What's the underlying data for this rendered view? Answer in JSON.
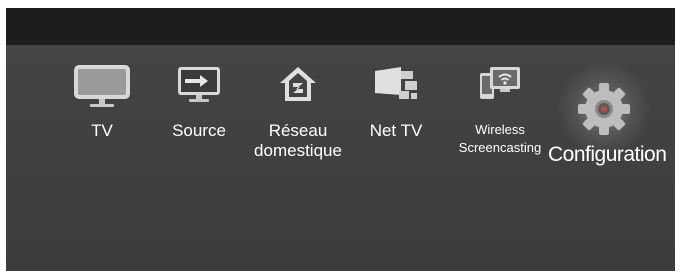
{
  "menu": {
    "items": [
      {
        "label": "TV",
        "icon": "tv-icon"
      },
      {
        "label": "Source",
        "icon": "source-icon"
      },
      {
        "label": "Réseau domestique",
        "icon": "home-network-icon"
      },
      {
        "label": "Net TV",
        "icon": "net-tv-icon"
      },
      {
        "label": "Wireless Screencasting",
        "icon": "wireless-screencasting-icon"
      },
      {
        "label": "Configuration",
        "icon": "gear-icon",
        "selected": true
      }
    ]
  },
  "colors": {
    "top_bar": "#1d1d1d",
    "background": "#3f3f3f",
    "text": "#ffffff"
  }
}
